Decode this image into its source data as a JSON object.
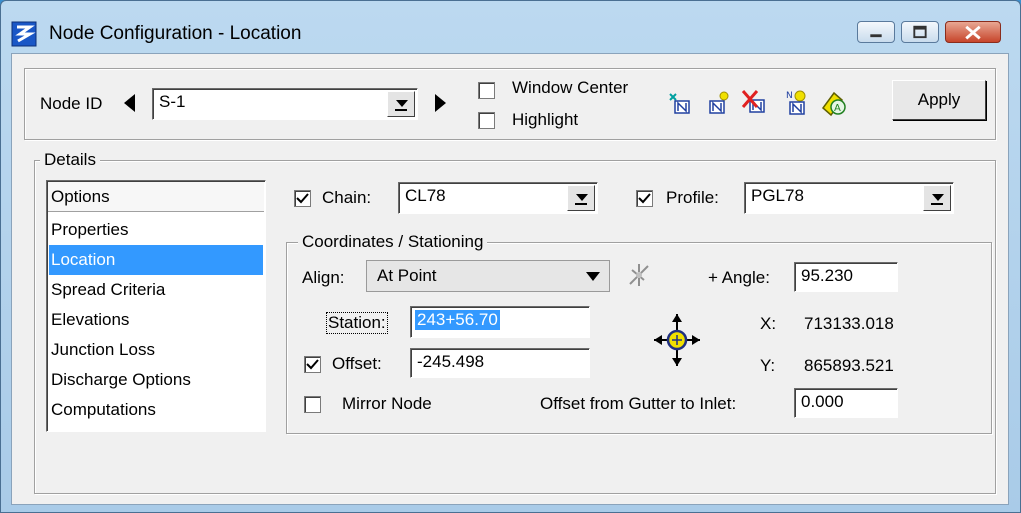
{
  "window": {
    "title": "Node Configuration - Location",
    "frame_color": "#a9cbe8",
    "client_color": "#f0f0f0",
    "selection_color": "#3399ff"
  },
  "top": {
    "node_id_label": "Node ID",
    "prev_icon": "left-triangle",
    "next_icon": "right-triangle",
    "node_id_value": "S-1",
    "window_center_label": "Window Center",
    "window_center_checked": false,
    "highlight_label": "Highlight",
    "highlight_checked": false,
    "tool_icons": [
      "add-node-icon",
      "place-node-icon",
      "delete-node-icon",
      "new-node-icon",
      "node-attributes-icon"
    ],
    "apply_label": "Apply"
  },
  "details": {
    "group_label": "Details",
    "options_header": "Options",
    "options": [
      "Properties",
      "Location",
      "Spread Criteria",
      "Elevations",
      "Junction Loss",
      "Discharge Options",
      "Computations"
    ],
    "selected_option": "Location",
    "chain_label": "Chain:",
    "chain_checked": true,
    "chain_value": "CL78",
    "profile_label": "Profile:",
    "profile_checked": true,
    "profile_value": "PGL78"
  },
  "coords": {
    "group_label": "Coordinates / Stationing",
    "align_label": "Align:",
    "align_value": "At Point",
    "angle_label": "+ Angle:",
    "angle_value": "95.230",
    "station_label": "Station:",
    "station_value": "243+56.70",
    "x_label": "X:",
    "x_value": "713133.018",
    "offset_label": "Offset:",
    "offset_checked": true,
    "offset_value": "-245.498",
    "y_label": "Y:",
    "y_value": "865893.521",
    "mirror_label": "Mirror Node",
    "mirror_checked": false,
    "gutter_label": "Offset from Gutter to Inlet:",
    "gutter_value": "0.000"
  }
}
